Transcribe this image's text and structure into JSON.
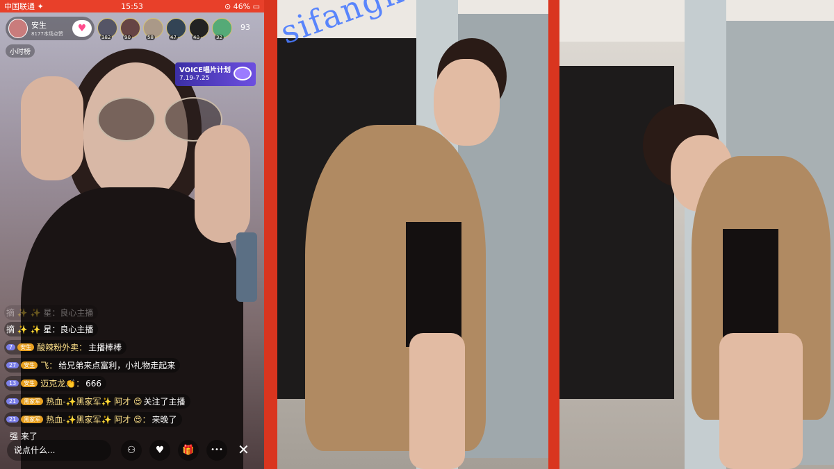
{
  "status_bar": {
    "carrier": "中国联通 ✦",
    "time": "15:53",
    "battery": "⊙ 46% ▭"
  },
  "host": {
    "name": "安生",
    "subtitle": "8177本场点赞",
    "heart": "♥"
  },
  "viewers": [
    {
      "level": "382"
    },
    {
      "level": "90"
    },
    {
      "level": "58"
    },
    {
      "level": "47"
    },
    {
      "level": "40"
    },
    {
      "level": "32"
    }
  ],
  "viewer_count": "93",
  "hour_rank": "小时榜",
  "voice_banner": {
    "title": "VOICE唱片计划",
    "dates": "7.19-7.25"
  },
  "chat": [
    {
      "text": "摘 ✨ ✨ 星：良心主播",
      "faded": true
    },
    {
      "text": "摘 ✨ ✨ 星：良心主播",
      "faded": false
    },
    {
      "level": "7",
      "badge": "安生",
      "name": "酸辣粉外卖：",
      "msg": "主播棒棒"
    },
    {
      "level": "27",
      "badge": "安生",
      "name": "飞：",
      "msg": "给兄弟来点富利，小礼物走起来"
    },
    {
      "level": "13",
      "badge": "安生",
      "name": "迈克龙👏：",
      "msg": "666"
    },
    {
      "level": "21",
      "badge": "黑家军",
      "name": "热血-✨黑家军✨ 阿才 😍",
      "msg": "关注了主播"
    },
    {
      "level": "21",
      "badge": "黑家军",
      "name": "热血-✨黑家军✨ 阿才 😍：",
      "msg": "来晚了"
    },
    {
      "plain": "强 来了"
    }
  ],
  "input_placeholder": "说点什么...",
  "tools": [
    "⚇",
    "♥",
    "🎁",
    "•••"
  ],
  "close": "✕",
  "watermark": "sifangktv.com"
}
